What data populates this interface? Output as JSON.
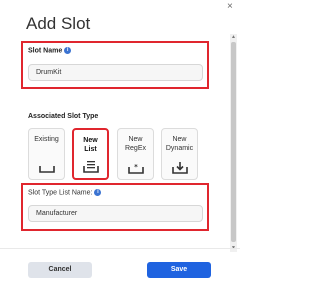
{
  "dialog": {
    "title": "Add Slot",
    "close_glyph": "×"
  },
  "slot_name": {
    "label": "Slot Name",
    "value": "DrumKit",
    "info_glyph": "i"
  },
  "slot_type": {
    "label": "Associated Slot Type",
    "options": [
      {
        "line1": "Existing",
        "line2": "",
        "icon": "tray-icon",
        "selected": false
      },
      {
        "line1": "New",
        "line2": "List",
        "icon": "list-tray-icon",
        "selected": true
      },
      {
        "line1": "New",
        "line2": "RegEx",
        "icon": "regex-tray-icon",
        "selected": false
      },
      {
        "line1": "New",
        "line2": "Dynamic",
        "icon": "download-tray-icon",
        "selected": false
      }
    ]
  },
  "list_name": {
    "label": "Slot Type List Name:",
    "value": "Manufacturer",
    "info_glyph": "i"
  },
  "footer": {
    "cancel_label": "Cancel",
    "save_label": "Save"
  },
  "scrollbar": {
    "up_glyph": "▲",
    "down_glyph": "▼"
  },
  "colors": {
    "highlight": "#e0262e",
    "primary": "#1f63e0",
    "info": "#3b73d1"
  }
}
